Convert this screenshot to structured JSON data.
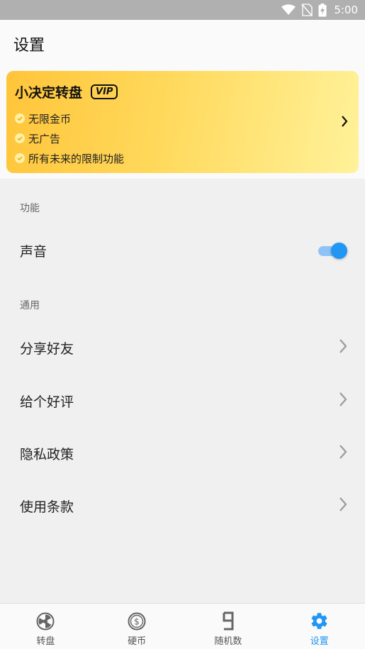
{
  "status_bar": {
    "time": "5:00",
    "icons": [
      "wifi-icon",
      "no-sim-icon",
      "battery-charging-icon"
    ]
  },
  "header": {
    "title": "设置"
  },
  "vip_card": {
    "title": "小决定转盘",
    "badge": "VIP",
    "features": [
      "无限金币",
      "无广告",
      "所有未来的限制功能"
    ],
    "icon": "chevron-right-icon"
  },
  "sections": {
    "features": {
      "label": "功能",
      "sound": {
        "label": "声音",
        "enabled": true
      }
    },
    "general": {
      "label": "通用",
      "items": [
        {
          "label": "分享好友",
          "icon": "chevron-right-icon"
        },
        {
          "label": "给个好评",
          "icon": "chevron-right-icon"
        },
        {
          "label": "隐私政策",
          "icon": "chevron-right-icon"
        },
        {
          "label": "使用条款",
          "icon": "chevron-right-icon"
        }
      ]
    }
  },
  "tab_bar": {
    "tabs": [
      {
        "label": "转盘",
        "icon": "wheel-icon",
        "active": false
      },
      {
        "label": "硬币",
        "icon": "coin-icon",
        "active": false
      },
      {
        "label": "随机数",
        "icon": "digit-nine-icon",
        "active": false
      },
      {
        "label": "设置",
        "icon": "gear-icon",
        "active": true
      }
    ]
  },
  "colors": {
    "accent": "#2196f3",
    "vip_gradient_start": "#ffc53a",
    "vip_gradient_end": "#fff29a",
    "background": "#f0f0f0"
  }
}
